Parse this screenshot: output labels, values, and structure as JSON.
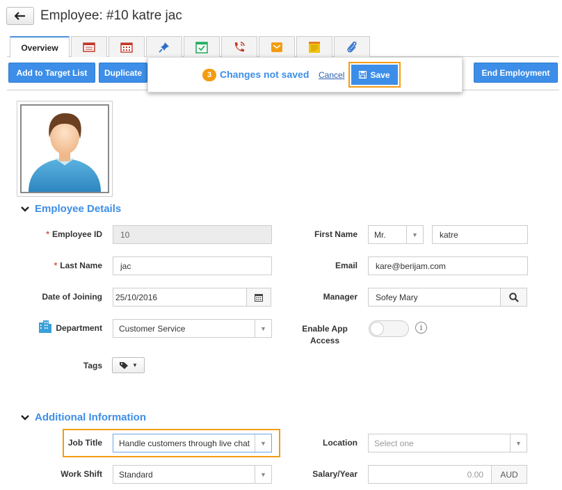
{
  "header": {
    "title": "Employee: #10 katre jac",
    "back_icon": "back-arrow-icon"
  },
  "tabs": [
    {
      "label": "Overview",
      "icon": null
    },
    {
      "label": "",
      "icon": "list-icon"
    },
    {
      "label": "",
      "icon": "calendar-icon"
    },
    {
      "label": "",
      "icon": "pin-icon"
    },
    {
      "label": "",
      "icon": "checklist-icon"
    },
    {
      "label": "",
      "icon": "phone-icon"
    },
    {
      "label": "",
      "icon": "mail-icon"
    },
    {
      "label": "",
      "icon": "note-icon"
    },
    {
      "label": "",
      "icon": "paperclip-icon"
    }
  ],
  "toolbar": {
    "add_to_target_list": "Add to Target List",
    "duplicate": "Duplicate",
    "end_employment": "End Employment"
  },
  "unsaved_popup": {
    "count": "3",
    "message": "Changes not saved",
    "cancel": "Cancel",
    "save": "Save"
  },
  "sections": {
    "employee_details": "Employee Details",
    "additional_information": "Additional Information"
  },
  "fields": {
    "employee_id": {
      "label": "Employee ID",
      "value": "10"
    },
    "last_name": {
      "label": "Last Name",
      "value": "jac"
    },
    "date_of_joining": {
      "label": "Date of Joining",
      "value": "25/10/2016"
    },
    "department": {
      "label": "Department",
      "value": "Customer Service"
    },
    "tags": {
      "label": "Tags"
    },
    "first_name": {
      "label": "First Name",
      "salutation": "Mr.",
      "value": "katre"
    },
    "email": {
      "label": "Email",
      "value": "kare@berijam.com"
    },
    "manager": {
      "label": "Manager",
      "value": "Sofey Mary"
    },
    "app_access": {
      "label_line1": "Enable App",
      "label_line2": "Access",
      "enabled": false
    },
    "job_title": {
      "label": "Job Title",
      "value": "Handle customers through live chat"
    },
    "work_shift": {
      "label": "Work Shift",
      "value": "Standard"
    },
    "location": {
      "label": "Location",
      "placeholder": "Select one"
    },
    "salary": {
      "label": "Salary/Year",
      "value": "0.00",
      "currency": "AUD"
    }
  },
  "colors": {
    "accent": "#3d8ee8",
    "highlight": "#f39c12",
    "required": "#d9534f"
  }
}
